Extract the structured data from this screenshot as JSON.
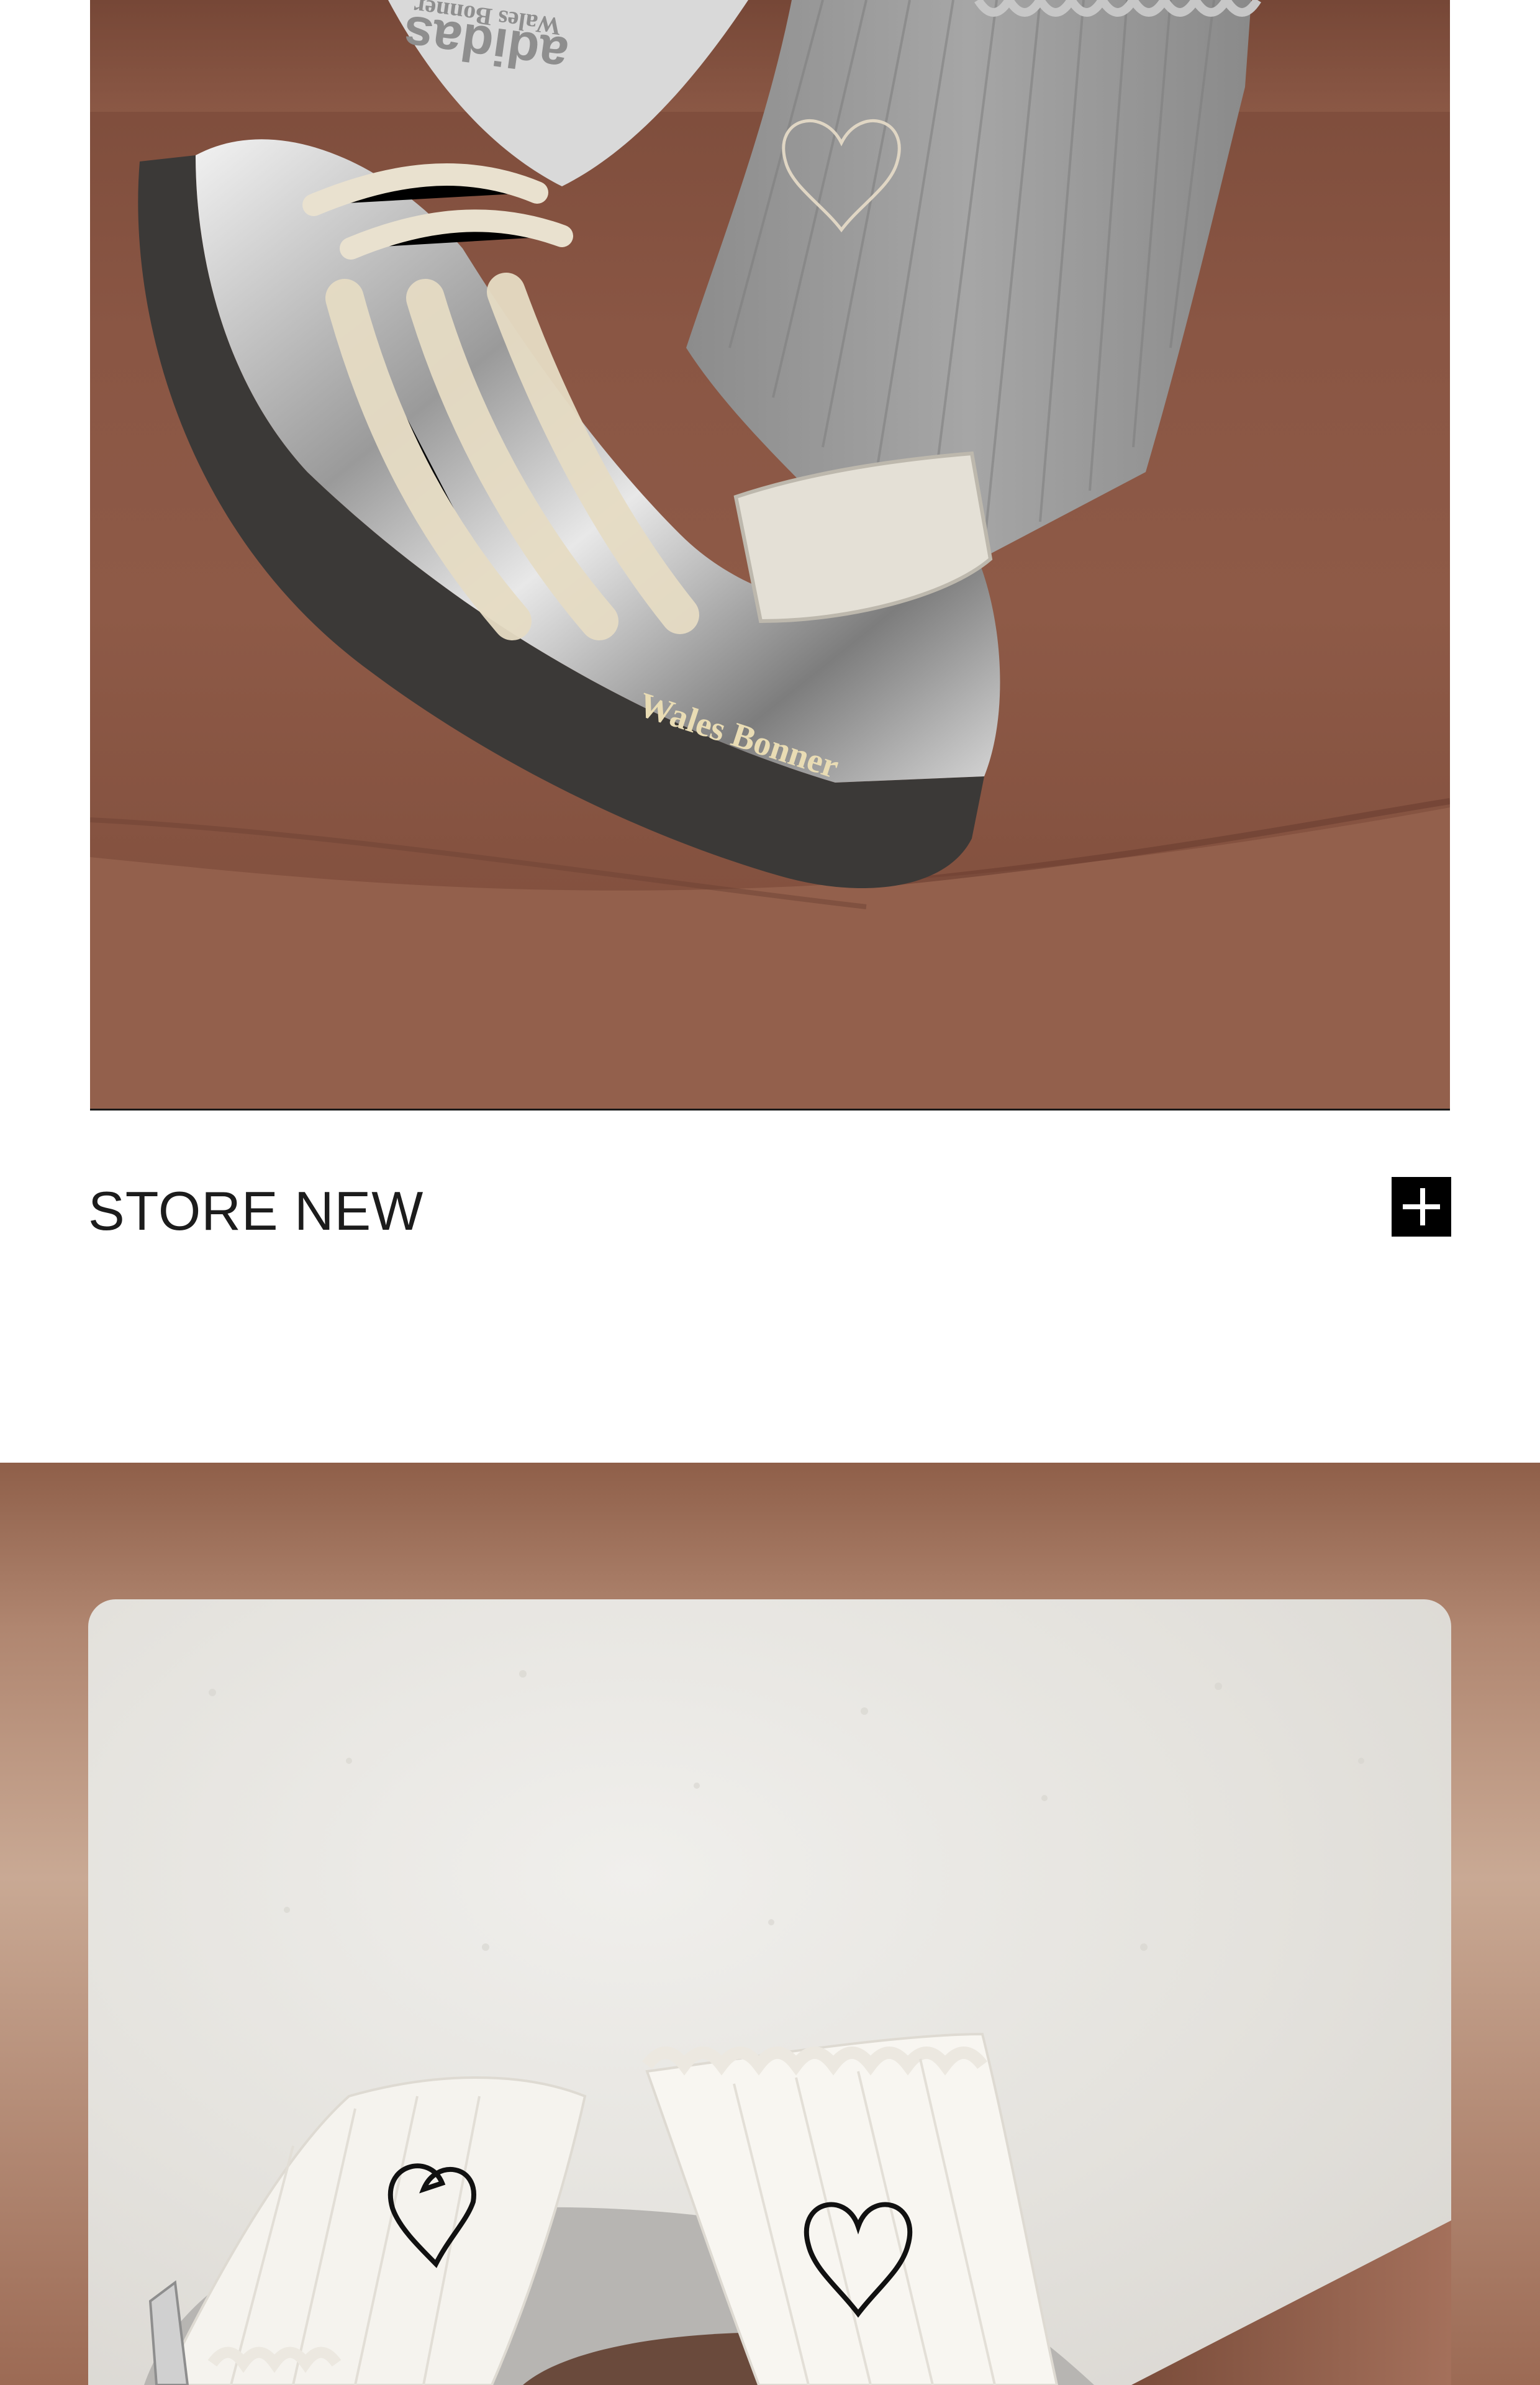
{
  "caption": {
    "label": "STORE NEW",
    "expand_icon": "plus-icon"
  },
  "photo_top": {
    "brand_heel_text": "Wales Bonner",
    "brand_tongue_text": "adidas",
    "brand_tongue_sub": "Wales Bonner"
  },
  "colors": {
    "sofa": "#8a5644",
    "sock_grey": "#9a9a9a",
    "silver": "#c9c9c9",
    "sole": "#3a3836",
    "card_bg": "#e6e4df",
    "white_sock": "#f6f4ef",
    "accent_black": "#000000"
  }
}
